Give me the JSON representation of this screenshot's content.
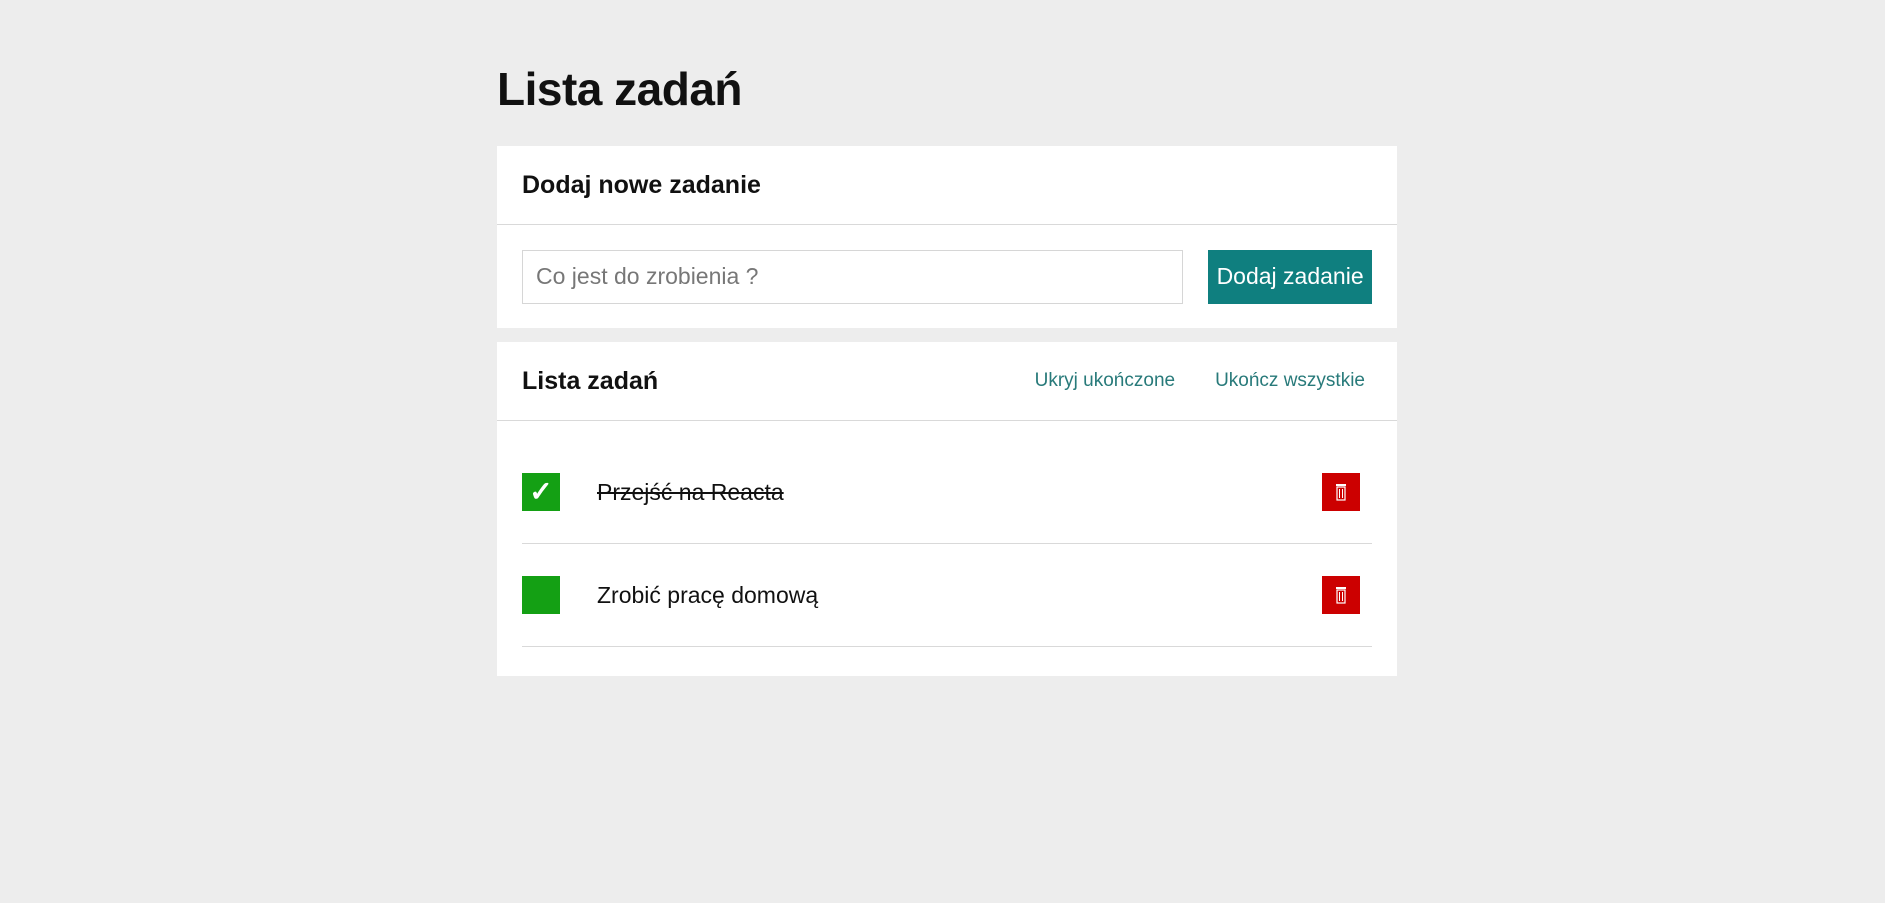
{
  "page": {
    "title": "Lista zadań"
  },
  "add_section": {
    "heading": "Dodaj nowe zadanie",
    "input_value": "",
    "input_placeholder": "Co jest do zrobienia ?",
    "button_label": "Dodaj zadanie"
  },
  "list_section": {
    "heading": "Lista zadań",
    "hide_done_label": "Ukryj ukończone",
    "complete_all_label": "Ukończ wszystkie",
    "tasks": [
      {
        "label": "Przejść na Reacta",
        "done": true,
        "check_glyph": "✓"
      },
      {
        "label": "Zrobić pracę domową",
        "done": false,
        "check_glyph": ""
      }
    ]
  },
  "colors": {
    "background": "#ededed",
    "accent": "#0f7f7f",
    "link": "#287a7a",
    "check": "#14a014",
    "delete": "#cc0000"
  },
  "icons": {
    "check": "checkmark-icon",
    "delete": "trash-icon"
  }
}
